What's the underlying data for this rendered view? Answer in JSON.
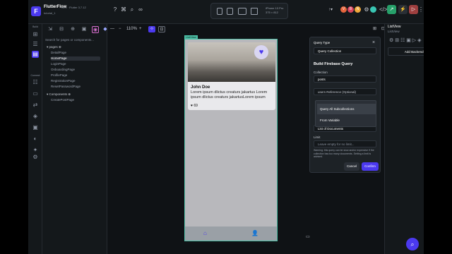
{
  "app": {
    "title": "FlutterFlow",
    "version": "v4.1 · Flutter 3.7.12",
    "project": "tutorial_1"
  },
  "device": {
    "name": "iPhone 13 Pro",
    "size": "375 × 812"
  },
  "badges": {
    "user1": "V",
    "user2": "B",
    "user3": "N"
  },
  "rail": {
    "build_label": "Build",
    "connect_label": "Connect"
  },
  "panel": {
    "search_placeholder": "Search for pages or components...",
    "pages_label": "pages",
    "pages": [
      "DetailPage",
      "HomePage",
      "LoginPage",
      "OnboardingPage",
      "ProfilePage",
      "RegistrationPage",
      "ResetPasswordPage"
    ],
    "components_label": "Components",
    "components": [
      "CreatePostPage"
    ]
  },
  "canvas": {
    "zoom": "110%",
    "listview_tag": "ListView",
    "card": {
      "name": "John Doe",
      "text": "Lorem ipsum dlictus creaturs jakartus Lorem ipsum dlictus creaturs jakartusLorem ipsum",
      "likes": "69"
    }
  },
  "modal": {
    "query_type_label": "Query Type",
    "query_type_value": "Query Collection",
    "build_heading": "Build Firebase Query",
    "collection_label": "Collection",
    "collection_value": "posts",
    "ref_value": "users Reference (Optional)",
    "dropdown_items": [
      "Query All Subcollections",
      "From Variable"
    ],
    "return_value": "List of Documents",
    "limit_label": "Limit",
    "limit_placeholder": "Leave empty for no limit...",
    "warning": "Warning: this query can be slow and/or expensive if the collection has too many documents. Setting a limit is advised.",
    "cancel": "Cancel",
    "confirm": "Confirm"
  },
  "right_panel": {
    "title": "ListView",
    "subtitle": "ListView",
    "add_query": "Add Backend Query"
  },
  "colors": {
    "accent": "#4b39ef",
    "selection": "#4dbfa6",
    "background": "#14181b"
  }
}
